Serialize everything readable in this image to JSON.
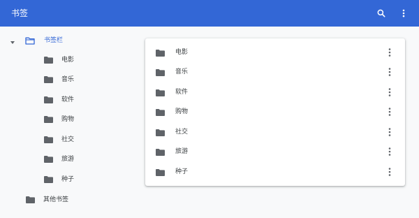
{
  "header": {
    "title": "书签",
    "search_icon": "search-icon",
    "more_icon": "more-vert-icon",
    "bar_color": "#3367d6"
  },
  "sidebar": {
    "root": {
      "label": "书签栏",
      "expanded": true,
      "selected": true
    },
    "children": [
      {
        "label": "电影"
      },
      {
        "label": "音乐"
      },
      {
        "label": "软件"
      },
      {
        "label": "购物"
      },
      {
        "label": "社交"
      },
      {
        "label": "旅游"
      },
      {
        "label": "种子"
      }
    ],
    "other": {
      "label": "其他书签"
    }
  },
  "list": {
    "items": [
      {
        "label": "电影"
      },
      {
        "label": "音乐"
      },
      {
        "label": "软件"
      },
      {
        "label": "购物"
      },
      {
        "label": "社交"
      },
      {
        "label": "旅游"
      },
      {
        "label": "种子"
      }
    ]
  },
  "colors": {
    "accent": "#3367d6",
    "folder_gray": "#5f6368",
    "text": "#3c4043"
  }
}
